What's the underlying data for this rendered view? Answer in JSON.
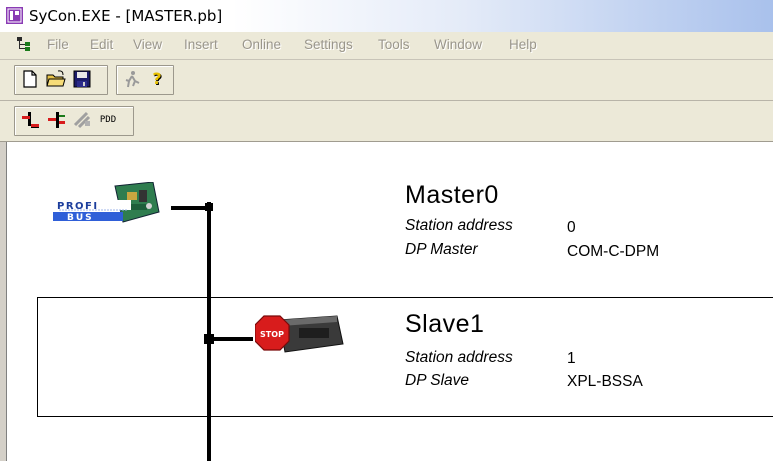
{
  "window": {
    "title": "SyCon.EXE - [MASTER.pb]",
    "app_icon": "app-icon"
  },
  "menu": {
    "items": [
      "File",
      "Edit",
      "View",
      "Insert",
      "Online",
      "Settings",
      "Tools",
      "Window",
      "Help"
    ]
  },
  "toolbar1": {
    "buttons": [
      "new-document-icon",
      "open-folder-icon",
      "save-icon",
      "run-icon",
      "help-icon"
    ]
  },
  "toolbar2": {
    "buttons": [
      "insert-master-icon",
      "insert-slave-icon",
      "disabled-tool-icon",
      "pdd-icon"
    ],
    "pdd_label": "PDD"
  },
  "network": {
    "master": {
      "name": "Master0",
      "station_address_label": "Station address",
      "station_address": "0",
      "type_label": "DP Master",
      "type_value": "COM-C-DPM",
      "icon": "profibus-master-icon"
    },
    "slave": {
      "name": "Slave1",
      "station_address_label": "Station address",
      "station_address": "1",
      "type_label": "DP Slave",
      "type_value": "XPL-BSSA",
      "icon": "stop-slave-icon",
      "stop_label": "STOP"
    }
  },
  "colors": {
    "bus": "#000000",
    "stop": "#d81c1c",
    "title_gradient_end": "#a9c1ec"
  }
}
